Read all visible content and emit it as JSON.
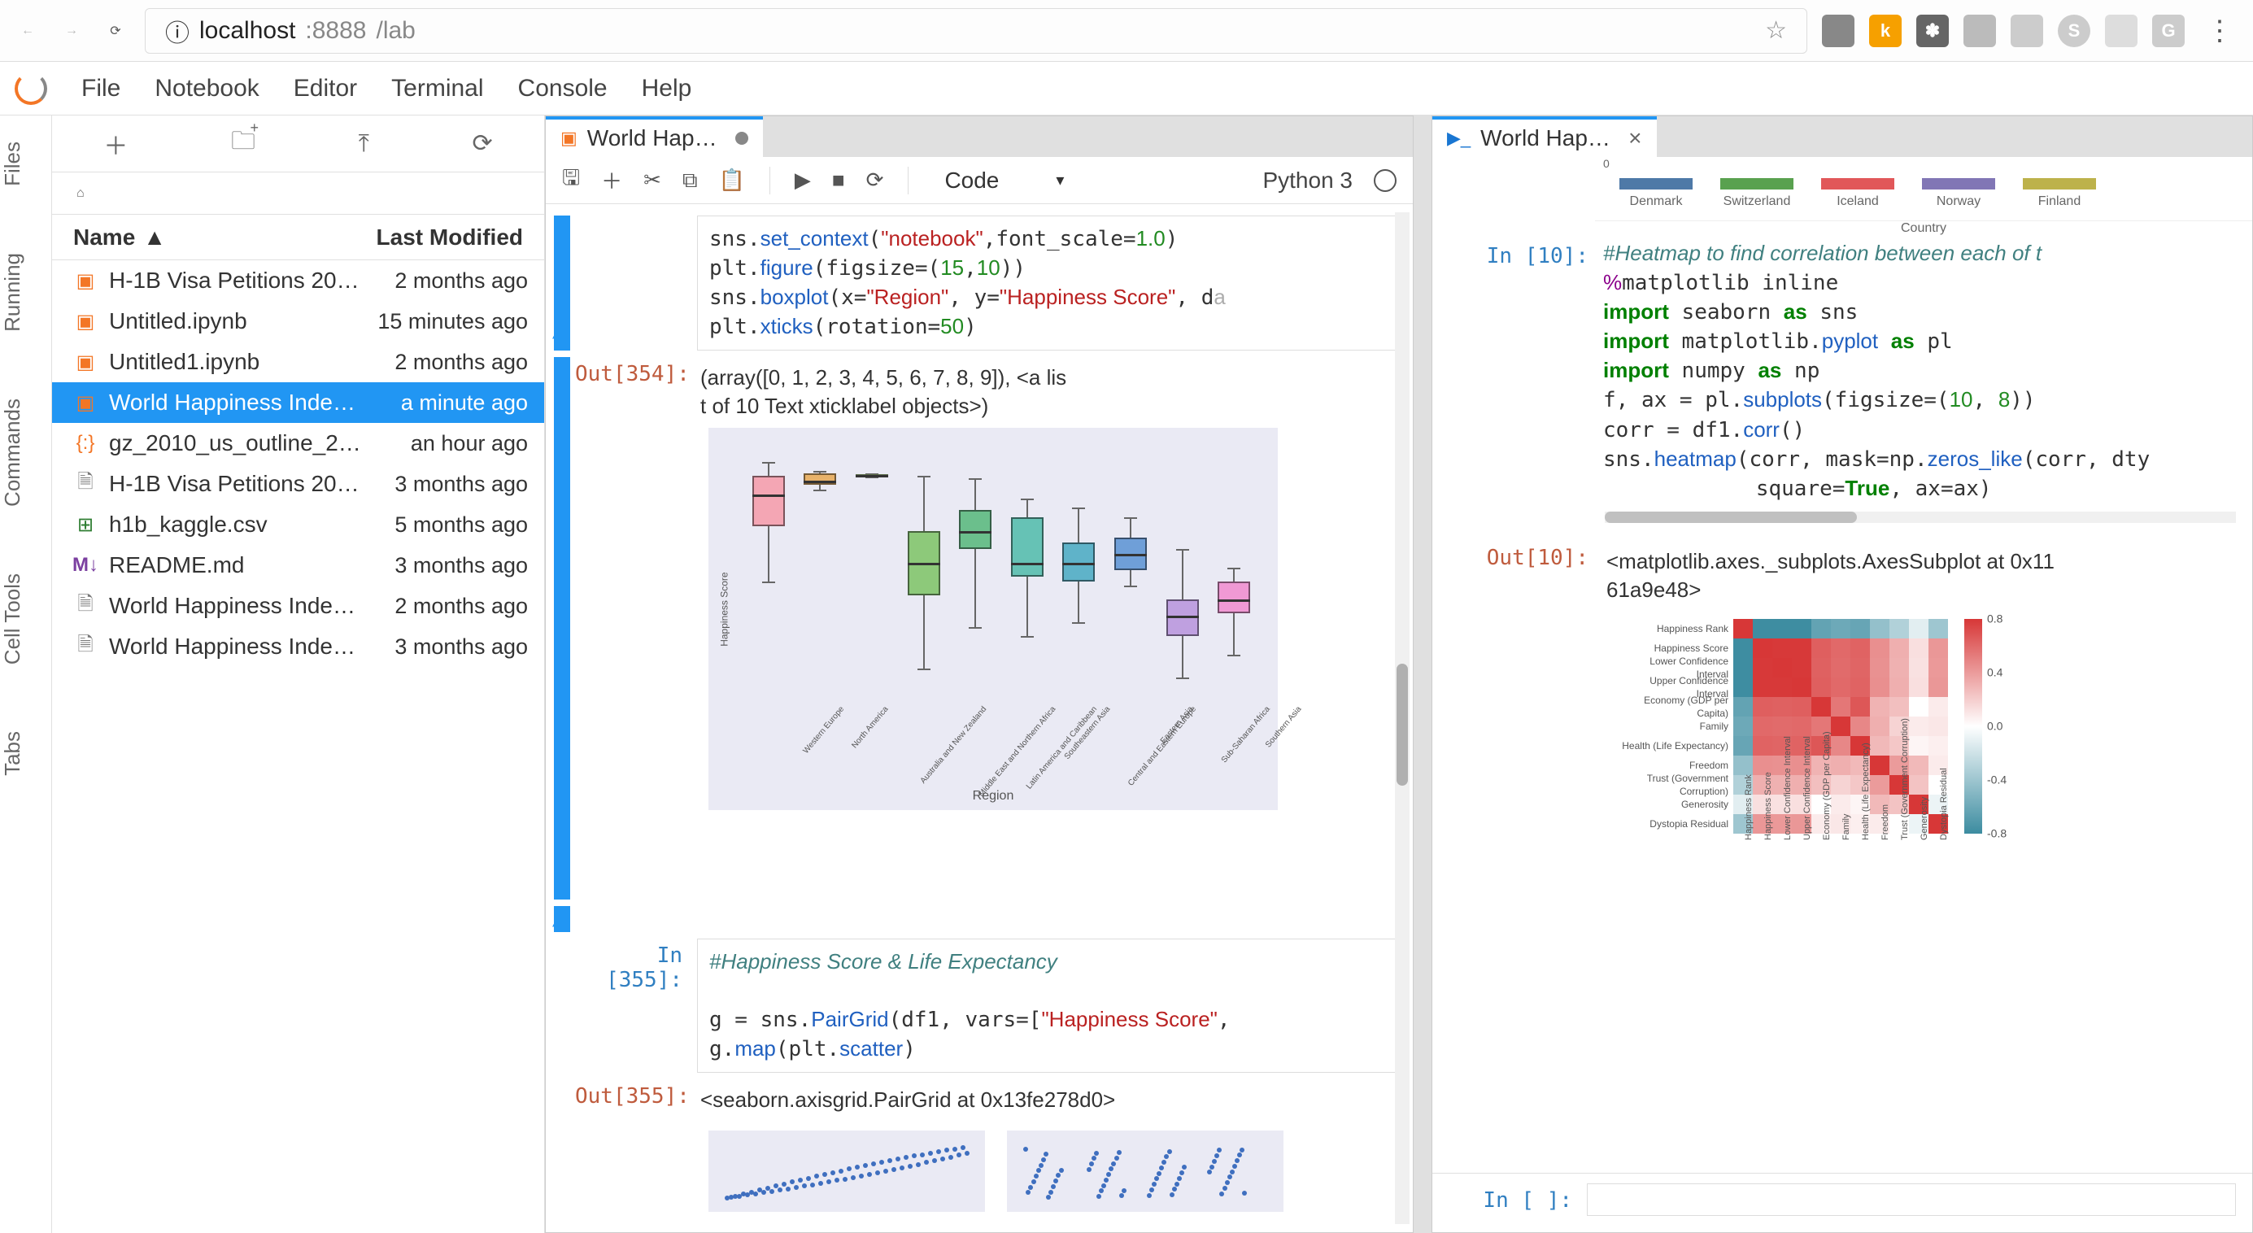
{
  "browser": {
    "url_info_icon": "ⓘ",
    "url_host": "localhost",
    "url_port": ":8888",
    "url_path": "/lab"
  },
  "menubar": {
    "items": [
      "File",
      "Notebook",
      "Editor",
      "Terminal",
      "Console",
      "Help"
    ]
  },
  "side_tabs": [
    "Files",
    "Running",
    "Commands",
    "Cell Tools",
    "Tabs"
  ],
  "filebrowser": {
    "header_name": "Name",
    "header_modified": "Last Modified",
    "files": [
      {
        "icon": "nb",
        "name": "H-1B Visa Petitions 20…",
        "mod": "2 months ago"
      },
      {
        "icon": "nb",
        "name": "Untitled.ipynb",
        "mod": "15 minutes ago"
      },
      {
        "icon": "nb",
        "name": "Untitled1.ipynb",
        "mod": "2 months ago"
      },
      {
        "icon": "nb",
        "name": "World Happiness Inde…",
        "mod": "a minute ago",
        "selected": true
      },
      {
        "icon": "code",
        "name": "gz_2010_us_outline_2…",
        "mod": "an hour ago"
      },
      {
        "icon": "file",
        "name": "H-1B Visa Petitions 20…",
        "mod": "3 months ago"
      },
      {
        "icon": "csv",
        "name": "h1b_kaggle.csv",
        "mod": "5 months ago"
      },
      {
        "icon": "md",
        "name": "README.md",
        "mod": "3 months ago"
      },
      {
        "icon": "file",
        "name": "World Happiness Inde…",
        "mod": "2 months ago"
      },
      {
        "icon": "file",
        "name": "World Happiness Inde…",
        "mod": "3 months ago"
      }
    ]
  },
  "left_panel": {
    "tab_title": "World Happine…",
    "celltype": "Code",
    "kernel": "Python 3",
    "cell354_in_prompt": "",
    "cell354_out_prompt": "Out[354]:",
    "cell354_output": "(array([0, 1, 2, 3, 4, 5, 6, 7, 8, 9]), <a lis\nt of 10 Text xticklabel objects>)",
    "cell355_prompt": "In [355]:",
    "cell355_out_prompt": "Out[355]:",
    "cell355_output": "<seaborn.axisgrid.PairGrid at 0x13fe278d0>"
  },
  "right_panel": {
    "tab_title": "World Happine:",
    "legend_countries": [
      {
        "name": "Denmark",
        "color": "#4e79a7"
      },
      {
        "name": "Switzerland",
        "color": "#59a14f"
      },
      {
        "name": "Iceland",
        "color": "#e15759"
      },
      {
        "name": "Norway",
        "color": "#8176b5"
      },
      {
        "name": "Finland",
        "color": "#bdb24b"
      }
    ],
    "legend_xlabel": "Country",
    "cell10_prompt": "In [10]:",
    "cell10_out_prompt": "Out[10]:",
    "cell10_output": "<matplotlib.axes._subplots.AxesSubplot at 0x11\n61a9e48>",
    "empty_prompt": "In [ ]:"
  },
  "chart_data": [
    {
      "type": "boxplot",
      "title": "",
      "xlabel": "Region",
      "ylabel": "Happiness Score",
      "ylim": [
        2.5,
        8
      ],
      "categories": [
        "Western Europe",
        "North America",
        "Australia and New Zealand",
        "Middle East and Northern Africa",
        "Latin America and Caribbean",
        "Southeastern Asia",
        "Central and Eastern Europe",
        "Eastern Asia",
        "Sub-Saharan Africa",
        "Southern Asia"
      ],
      "series": [
        {
          "min": 5.0,
          "q1": 6.2,
          "median": 6.9,
          "q3": 7.3,
          "max": 7.6,
          "color": "#f4a6b4"
        },
        {
          "min": 7.0,
          "q1": 7.1,
          "median": 7.2,
          "q3": 7.35,
          "max": 7.4,
          "color": "#e8b26a"
        },
        {
          "min": 7.28,
          "q1": 7.3,
          "median": 7.32,
          "q3": 7.34,
          "max": 7.36,
          "color": "#bfe09a"
        },
        {
          "min": 3.1,
          "q1": 4.7,
          "median": 5.4,
          "q3": 6.1,
          "max": 7.3,
          "color": "#8dc97a"
        },
        {
          "min": 4.0,
          "q1": 5.7,
          "median": 6.1,
          "q3": 6.55,
          "max": 7.25,
          "color": "#6bbf8c"
        },
        {
          "min": 3.8,
          "q1": 5.1,
          "median": 5.4,
          "q3": 6.4,
          "max": 6.8,
          "color": "#66c2b5"
        },
        {
          "min": 4.1,
          "q1": 5.0,
          "median": 5.4,
          "q3": 5.85,
          "max": 6.6,
          "color": "#5fb3c9"
        },
        {
          "min": 4.9,
          "q1": 5.25,
          "median": 5.6,
          "q3": 5.95,
          "max": 6.4,
          "color": "#6f9fd8"
        },
        {
          "min": 2.9,
          "q1": 3.8,
          "median": 4.25,
          "q3": 4.6,
          "max": 5.7,
          "color": "#bfa0e0"
        },
        {
          "min": 3.4,
          "q1": 4.3,
          "median": 4.6,
          "q3": 5.0,
          "max": 5.3,
          "color": "#f099d4"
        }
      ]
    },
    {
      "type": "heatmap",
      "labels": [
        "Happiness Rank",
        "Happiness Score",
        "Lower Confidence Interval",
        "Upper Confidence Interval",
        "Economy (GDP per Capita)",
        "Family",
        "Health (Life Expectancy)",
        "Freedom",
        "Trust (Government Corruption)",
        "Generosity",
        "Dystopia Residual"
      ],
      "colorbar": {
        "min": -0.8,
        "max": 0.8,
        "ticks": [
          -0.8,
          -0.4,
          0.0,
          0.4,
          0.8
        ]
      },
      "values": [
        [
          1.0,
          -0.99,
          -0.99,
          -0.99,
          -0.8,
          -0.75,
          -0.78,
          -0.55,
          -0.4,
          -0.15,
          -0.5
        ],
        [
          -0.99,
          1.0,
          0.99,
          0.99,
          0.8,
          0.75,
          0.78,
          0.56,
          0.4,
          0.16,
          0.52
        ],
        [
          -0.99,
          0.99,
          1.0,
          0.99,
          0.79,
          0.74,
          0.77,
          0.55,
          0.39,
          0.15,
          0.51
        ],
        [
          -0.99,
          0.99,
          0.99,
          1.0,
          0.8,
          0.75,
          0.78,
          0.56,
          0.4,
          0.16,
          0.52
        ],
        [
          -0.8,
          0.8,
          0.79,
          0.8,
          1.0,
          0.68,
          0.84,
          0.38,
          0.32,
          0.0,
          0.1
        ],
        [
          -0.75,
          0.75,
          0.74,
          0.75,
          0.68,
          1.0,
          0.6,
          0.4,
          0.22,
          0.1,
          0.12
        ],
        [
          -0.78,
          0.78,
          0.77,
          0.78,
          0.84,
          0.6,
          1.0,
          0.35,
          0.28,
          0.05,
          0.08
        ],
        [
          -0.55,
          0.56,
          0.55,
          0.56,
          0.38,
          0.4,
          0.35,
          1.0,
          0.5,
          0.35,
          0.1
        ],
        [
          -0.4,
          0.4,
          0.39,
          0.4,
          0.32,
          0.22,
          0.28,
          0.5,
          1.0,
          0.3,
          0.0
        ],
        [
          -0.15,
          0.16,
          0.15,
          0.16,
          0.0,
          0.1,
          0.05,
          0.35,
          0.3,
          1.0,
          -0.1
        ],
        [
          -0.5,
          0.52,
          0.51,
          0.52,
          0.1,
          0.12,
          0.08,
          0.1,
          0.0,
          -0.1,
          1.0
        ]
      ]
    }
  ]
}
